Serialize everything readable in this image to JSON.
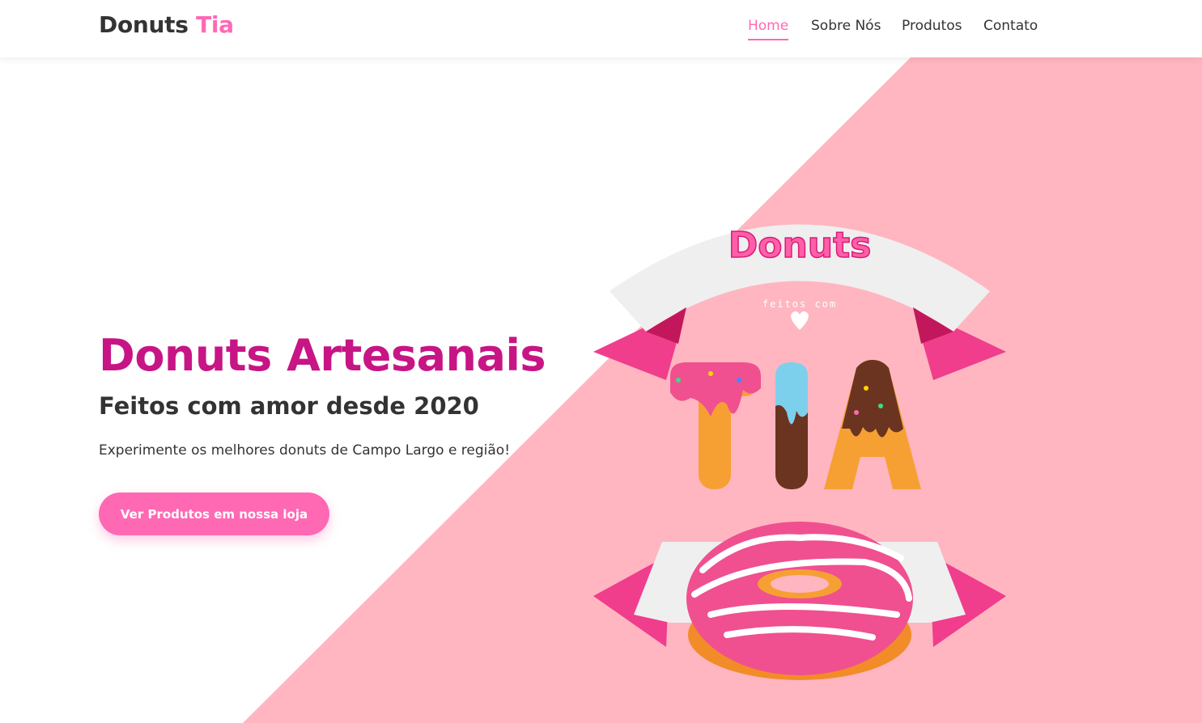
{
  "brand": {
    "name": "Donuts",
    "accent": "Tia"
  },
  "nav": {
    "home": "Home",
    "about": "Sobre Nós",
    "products": "Produtos",
    "contact": "Contato"
  },
  "hero": {
    "title": "Donuts Artesanais",
    "subtitle": "Feitos com amor desde 2020",
    "description": "Experimente os melhores donuts de Campo Largo e região!",
    "cta_label": "Ver Produtos em nossa loja"
  },
  "badge": {
    "top_word": "Donuts",
    "tagline": "feitos com",
    "big_word": "TIA"
  },
  "colors": {
    "brand_pink": "#ff69b4",
    "title_magenta": "#c71585",
    "hero_pink_bg": "#ffb6c1"
  }
}
